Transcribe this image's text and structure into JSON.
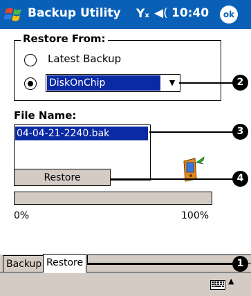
{
  "title_bar": {
    "app_title": "Backup Utility",
    "signal_icon": "signal-off-icon",
    "volume_icon": "speaker-icon",
    "time": "10:40",
    "ok_label": "ok"
  },
  "restore_from": {
    "legend": "Restore From:",
    "option_latest": "Latest Backup",
    "selected_option": "diskonchip",
    "select_value": "DiskOnChip"
  },
  "file_name": {
    "label": "File Name:",
    "files": [
      "04-04-21-2240.bak"
    ],
    "selected_index": 0
  },
  "restore_button": "Restore",
  "progress": {
    "value": 0,
    "min_label": "0%",
    "max_label": "100%"
  },
  "tabs": [
    {
      "label": "Backup",
      "active": false
    },
    {
      "label": "Restore",
      "active": true
    }
  ],
  "callouts": [
    "1",
    "2",
    "3",
    "4"
  ],
  "colors": {
    "title_bar": "#0a60b6",
    "selection": "#0a2aa4",
    "control_face": "#d4ccc4"
  }
}
